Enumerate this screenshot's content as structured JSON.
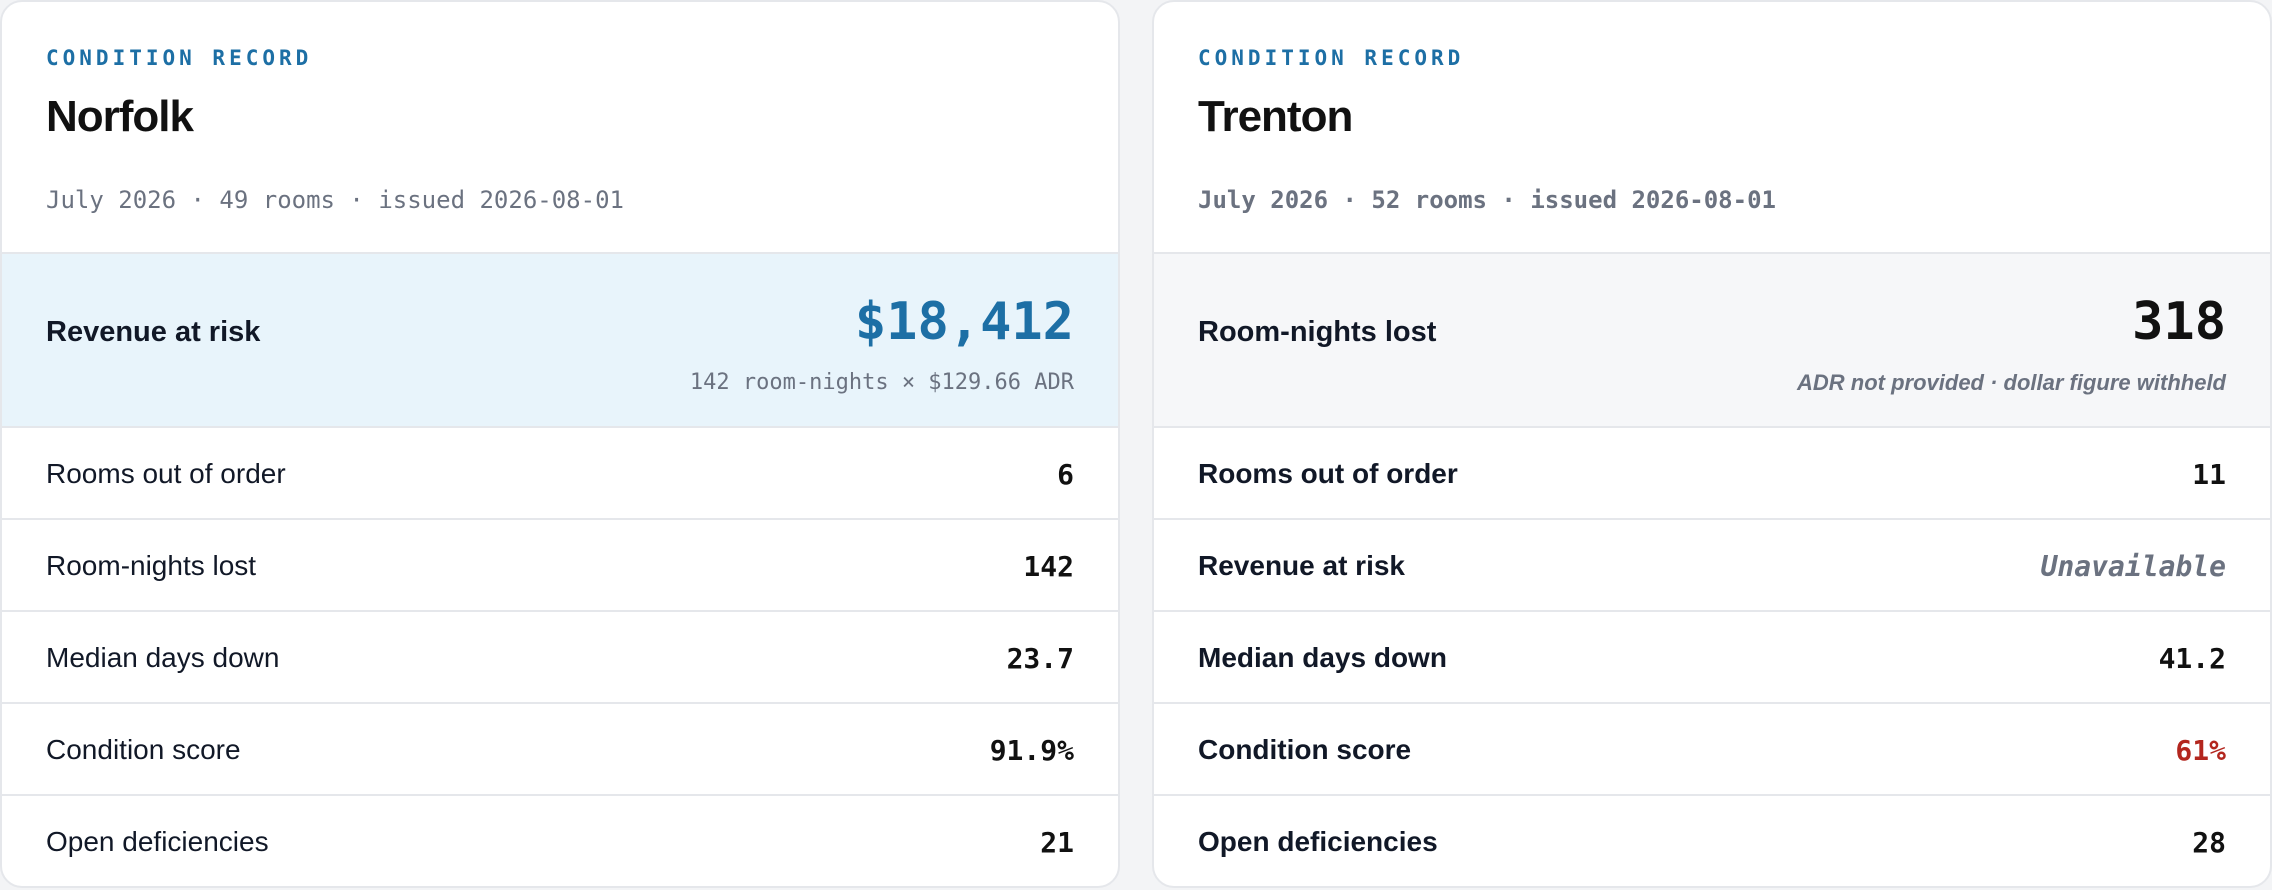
{
  "cards": [
    {
      "eyebrow": "CONDITION RECORD",
      "city": "Norfolk",
      "meta": "July 2026 · 49 rooms · issued 2026-08-01",
      "feature": {
        "label": "Revenue at risk",
        "value": "$18,412",
        "note": "142 room-nights × $129.66 ADR"
      },
      "rows": [
        {
          "label": "Rooms out of order",
          "value": "6"
        },
        {
          "label": "Room-nights lost",
          "value": "142"
        },
        {
          "label": "Median days down",
          "value": "23.7"
        },
        {
          "label": "Condition score",
          "value": "91.9%"
        },
        {
          "label": "Open deficiencies",
          "value": "21"
        }
      ]
    },
    {
      "eyebrow": "CONDITION RECORD",
      "city": "Trenton",
      "meta": "July 2026 · 52 rooms · issued 2026-08-01",
      "feature": {
        "label": "Room-nights lost",
        "value": "318",
        "note": "ADR not provided · dollar figure withheld"
      },
      "rows": [
        {
          "label": "Rooms out of order",
          "value": "11"
        },
        {
          "label": "Revenue at risk",
          "value": "Unavailable"
        },
        {
          "label": "Median days down",
          "value": "41.2"
        },
        {
          "label": "Condition score",
          "value": "61%"
        },
        {
          "label": "Open deficiencies",
          "value": "28"
        }
      ]
    }
  ],
  "colors": {
    "accent": "#1d6fa5",
    "warning": "#b3261e",
    "muted": "#6b7280"
  }
}
